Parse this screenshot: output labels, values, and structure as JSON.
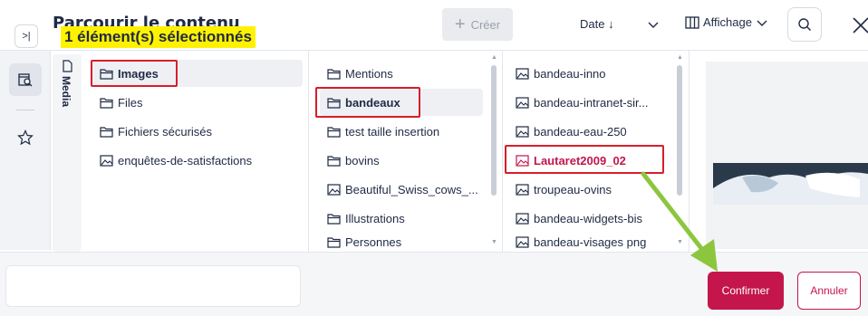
{
  "header": {
    "title": "Parcourir le contenu",
    "create_label": "Créer",
    "sort_label": "Date ↓",
    "display_label": "Affichage"
  },
  "vertical_tab": {
    "label": "Media"
  },
  "columns": [
    {
      "items": [
        {
          "label": "Images",
          "type": "folder"
        },
        {
          "label": "Files",
          "type": "folder"
        },
        {
          "label": "Fichiers sécurisés",
          "type": "folder"
        },
        {
          "label": "enquêtes-de-satisfactions",
          "type": "image"
        }
      ]
    },
    {
      "items": [
        {
          "label": "Mentions",
          "type": "folder"
        },
        {
          "label": "bandeaux",
          "type": "folder"
        },
        {
          "label": "test taille insertion",
          "type": "folder"
        },
        {
          "label": "bovins",
          "type": "folder"
        },
        {
          "label": "Beautiful_Swiss_cows_...",
          "type": "image"
        },
        {
          "label": "Illustrations",
          "type": "folder"
        },
        {
          "label": "Personnes",
          "type": "folder"
        }
      ]
    },
    {
      "items": [
        {
          "label": "bandeau-inno",
          "type": "image"
        },
        {
          "label": "bandeau-intranet-sir...",
          "type": "image"
        },
        {
          "label": "bandeau-eau-250",
          "type": "image"
        },
        {
          "label": "Lautaret2009_02",
          "type": "image"
        },
        {
          "label": "troupeau-ovins",
          "type": "image"
        },
        {
          "label": "bandeau-widgets-bis",
          "type": "image"
        },
        {
          "label": "bandeau-visages png",
          "type": "image"
        }
      ]
    }
  ],
  "footer": {
    "selection_text": "1 élément(s) sélectionnés",
    "confirm_label": "Confirmer",
    "cancel_label": "Annuler"
  },
  "colors": {
    "accent": "#c4154c",
    "highlight_box": "#d71e2a",
    "selection_highlight": "#fff200",
    "annotation_arrow": "#8cc63f"
  }
}
